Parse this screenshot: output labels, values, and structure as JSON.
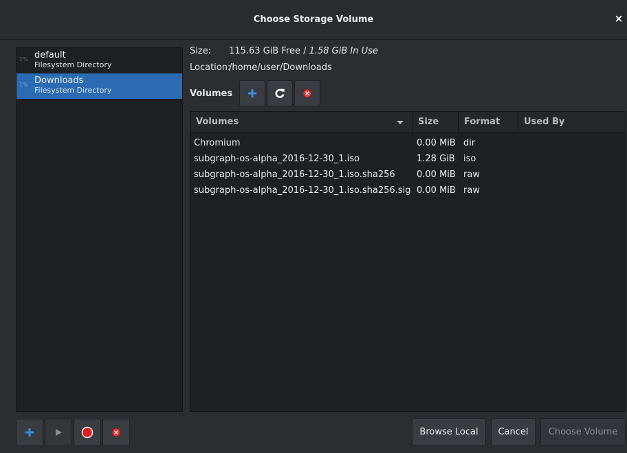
{
  "window": {
    "title": "Choose Storage Volume",
    "close_glyph": "×"
  },
  "pools": [
    {
      "usage": "1%",
      "name": "default",
      "type": "Filesystem Directory",
      "selected": false
    },
    {
      "usage": "1%",
      "name": "Downloads",
      "type": "Filesystem Directory",
      "selected": true
    }
  ],
  "info": {
    "size_label": "Size:",
    "size_free": "115.63 GiB Free / ",
    "size_inuse": "1.58 GiB In Use",
    "location_label": "Location:",
    "location_value": "/home/user/Downloads"
  },
  "volumes_toolbar": {
    "label": "Volumes",
    "buttons": [
      "add-icon",
      "refresh-icon",
      "delete-icon"
    ]
  },
  "table": {
    "columns": [
      "Volumes",
      "Size",
      "Format",
      "Used By"
    ],
    "rows": [
      {
        "name": "Chromium",
        "size": "0.00 MiB",
        "format": "dir",
        "used_by": ""
      },
      {
        "name": "subgraph-os-alpha_2016-12-30_1.iso",
        "size": "1.28 GiB",
        "format": "iso",
        "used_by": ""
      },
      {
        "name": "subgraph-os-alpha_2016-12-30_1.iso.sha256",
        "size": "0.00 MiB",
        "format": "raw",
        "used_by": ""
      },
      {
        "name": "subgraph-os-alpha_2016-12-30_1.iso.sha256.sig",
        "size": "0.00 MiB",
        "format": "raw",
        "used_by": ""
      }
    ]
  },
  "pool_buttons": [
    "add-pool-icon",
    "start-pool-icon",
    "stop-pool-icon",
    "delete-pool-icon"
  ],
  "dialog_buttons": {
    "browse_local": "Browse Local",
    "cancel": "Cancel",
    "choose_volume": "Choose Volume"
  },
  "colors": {
    "accent": "#2a6bb3",
    "plus_icon": "#3b8ee0",
    "stop_red": "#e01b1b",
    "delete_red": "#d03a3a"
  }
}
